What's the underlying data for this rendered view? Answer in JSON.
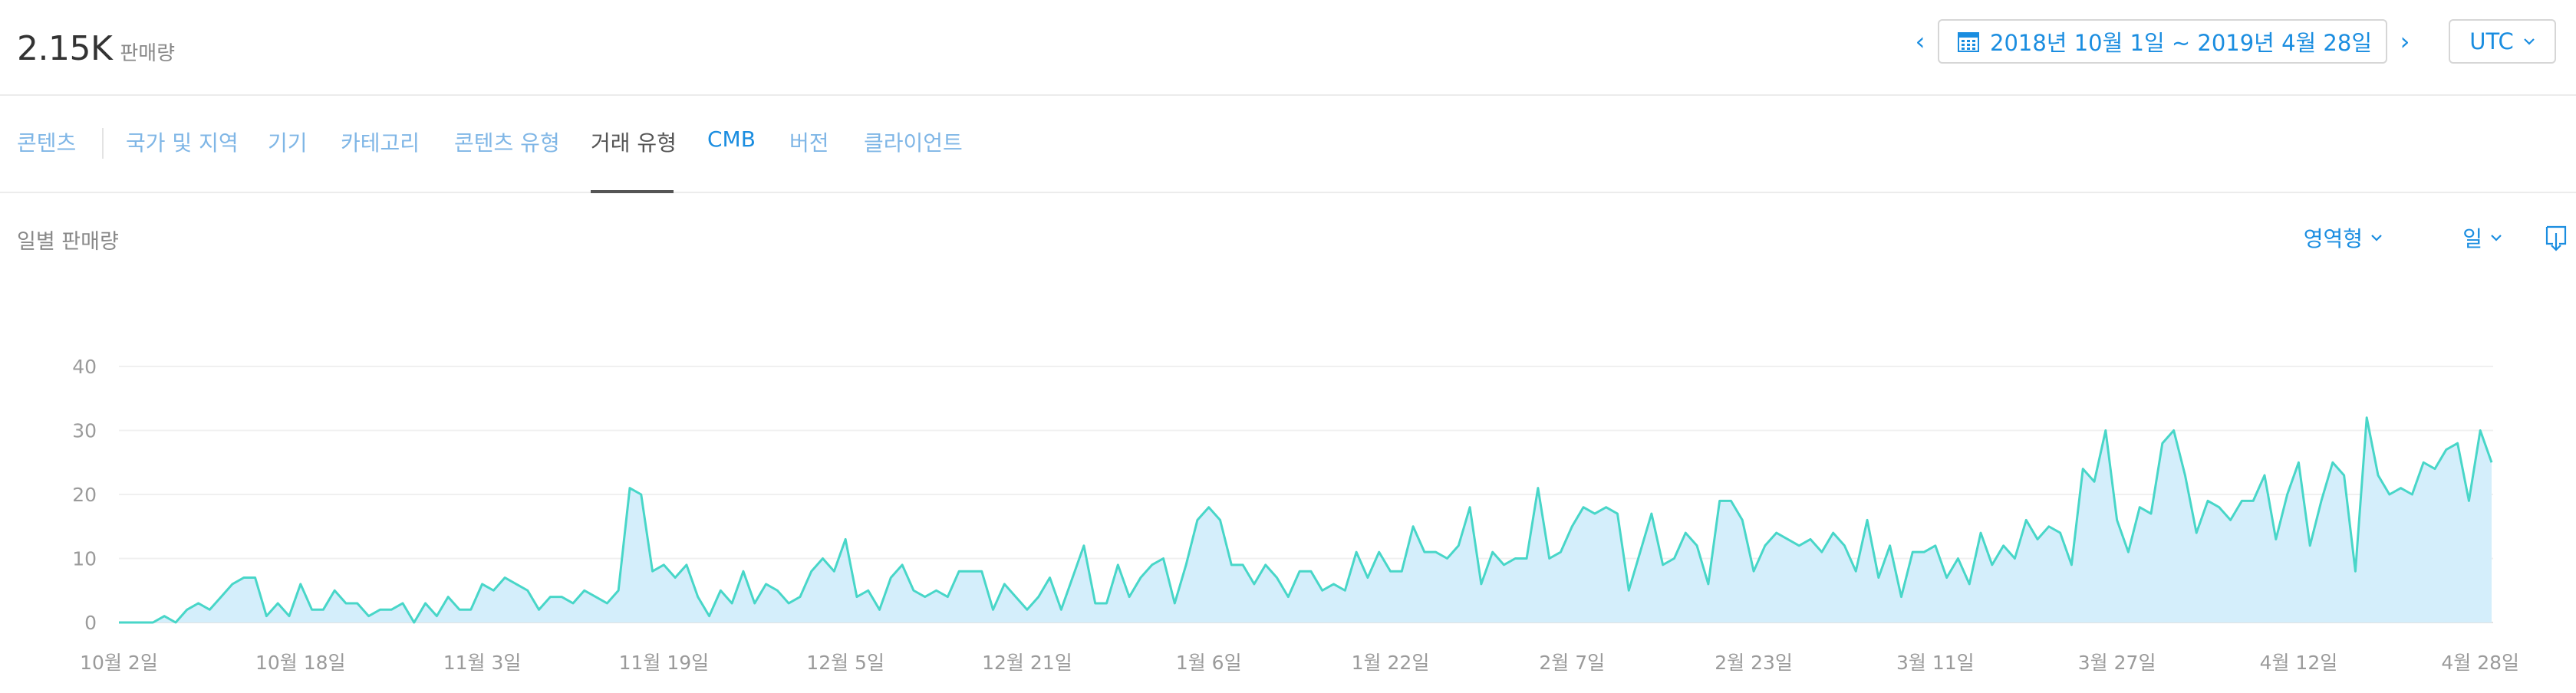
{
  "summary": {
    "value": "2.15K",
    "label": "판매량"
  },
  "date_nav": {
    "prev_icon": "‹",
    "next_icon": "›",
    "range": "2018년 10월 1일 ~ 2019년 4월 28일",
    "timezone": "UTC"
  },
  "tabs": [
    {
      "label": "콘텐츠"
    },
    {
      "label": "국가 및 지역"
    },
    {
      "label": "기기"
    },
    {
      "label": "카테고리"
    },
    {
      "label": "콘텐츠 유형"
    },
    {
      "label": "거래 유형"
    },
    {
      "label": "CMB"
    },
    {
      "label": "버전"
    },
    {
      "label": "클라이언트"
    }
  ],
  "active_tab": "거래 유형",
  "section": {
    "title": "일별 판매량",
    "chart_type_select": "영역형",
    "interval_select": "일"
  },
  "colors": {
    "accent": "#1a8de0",
    "line": "#48d6c8",
    "fill": "#d4eefb"
  },
  "chart_data": {
    "type": "area",
    "title": "",
    "xlabel": "",
    "ylabel": "",
    "ylim": [
      0,
      40
    ],
    "yticks": [
      0,
      10,
      20,
      30,
      40
    ],
    "grid": true,
    "x_tick_labels": [
      "10월 2일",
      "10월 18일",
      "11월 3일",
      "11월 19일",
      "12월 5일",
      "12월 21일",
      "1월 6일",
      "1월 22일",
      "2월 7일",
      "2월 23일",
      "3월 11일",
      "3월 27일",
      "4월 12일",
      "4월 28일"
    ],
    "x_start": "2018-10-02",
    "x_end": "2019-04-28",
    "values": [
      0,
      0,
      0,
      0,
      1,
      0,
      2,
      3,
      2,
      4,
      6,
      7,
      7,
      1,
      3,
      1,
      6,
      2,
      2,
      5,
      3,
      3,
      1,
      2,
      2,
      3,
      0,
      3,
      1,
      4,
      2,
      2,
      6,
      5,
      7,
      6,
      5,
      2,
      4,
      4,
      3,
      5,
      4,
      3,
      5,
      21,
      20,
      8,
      9,
      7,
      9,
      4,
      1,
      5,
      3,
      8,
      3,
      6,
      5,
      3,
      4,
      8,
      10,
      8,
      13,
      4,
      5,
      2,
      7,
      9,
      5,
      4,
      5,
      4,
      8,
      8,
      8,
      2,
      6,
      4,
      2,
      4,
      7,
      2,
      7,
      12,
      3,
      3,
      9,
      4,
      7,
      9,
      10,
      3,
      9,
      16,
      18,
      16,
      9,
      9,
      6,
      9,
      7,
      4,
      8,
      8,
      5,
      6,
      5,
      11,
      7,
      11,
      8,
      8,
      15,
      11,
      11,
      10,
      12,
      18,
      6,
      11,
      9,
      10,
      10,
      21,
      10,
      11,
      15,
      18,
      17,
      18,
      17,
      5,
      11,
      17,
      9,
      10,
      14,
      12,
      6,
      19,
      19,
      16,
      8,
      12,
      14,
      13,
      12,
      13,
      11,
      14,
      12,
      8,
      16,
      7,
      12,
      4,
      11,
      11,
      12,
      7,
      10,
      6,
      14,
      9,
      12,
      10,
      16,
      13,
      15,
      14,
      9,
      24,
      22,
      30,
      16,
      11,
      18,
      17,
      28,
      30,
      23,
      14,
      19,
      18,
      16,
      19,
      19,
      23,
      13,
      20,
      25,
      12,
      19,
      25,
      23,
      8,
      32,
      23,
      20,
      21,
      20,
      25,
      24,
      27,
      28,
      19,
      30,
      25
    ]
  }
}
